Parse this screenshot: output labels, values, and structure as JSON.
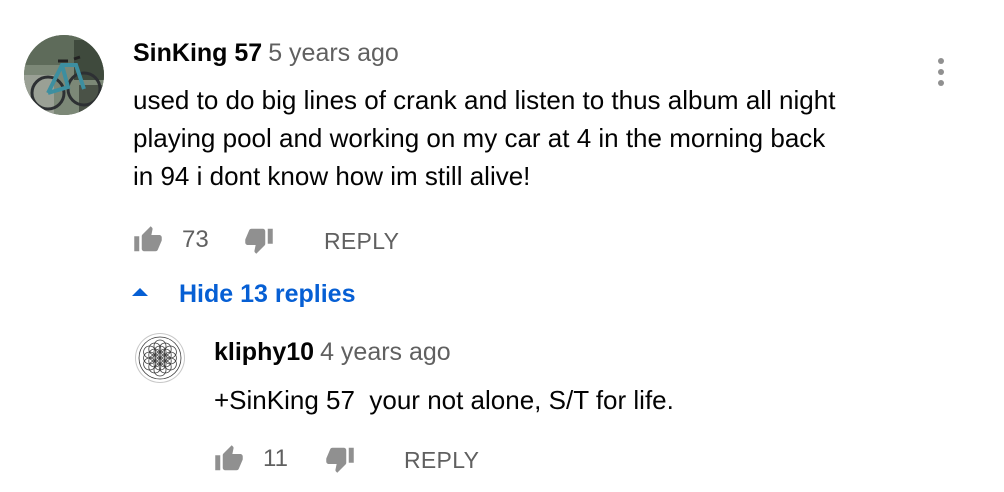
{
  "comment": {
    "author": "SinKing 57",
    "time": "5 years ago",
    "text": "used to do big lines of crank and listen to thus album all night\nplaying pool and working on my car at 4 in the morning back\nin 94 i dont know how im still alive!",
    "likes": "73",
    "reply_label": "REPLY",
    "avatar_icon": "bicycle-photo-avatar",
    "menu_icon": "more-vert-icon"
  },
  "replies_toggle": {
    "label": "Hide 13 replies",
    "icon": "chevron-up-icon",
    "color": "#065fd4"
  },
  "reply": {
    "author": "kliphy10",
    "time": "4 years ago",
    "text": "+SinKing 57  your not alone, S/T for life.",
    "likes": "11",
    "reply_label": "REPLY",
    "avatar_icon": "flower-of-life-avatar"
  }
}
